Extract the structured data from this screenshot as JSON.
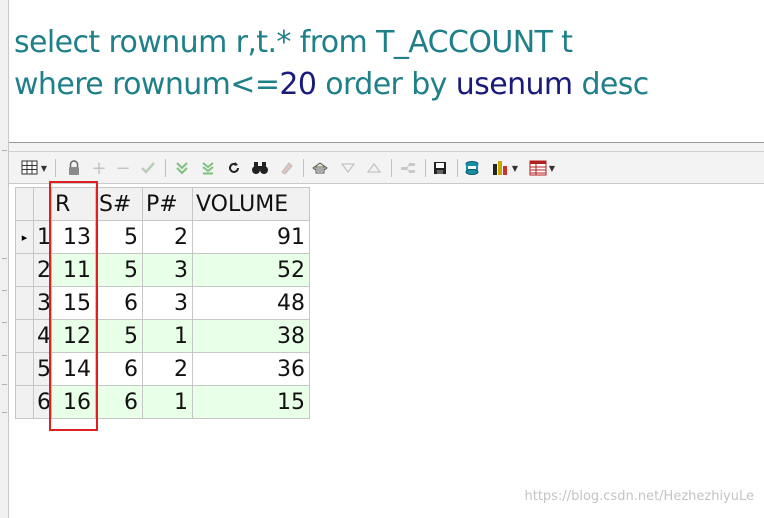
{
  "editor": {
    "line1": [
      {
        "text": "select ",
        "kind": "kw"
      },
      {
        "text": "rownum ",
        "kind": "kw"
      },
      {
        "text": "r,t.* ",
        "kind": "kw"
      },
      {
        "text": "from ",
        "kind": "kw"
      },
      {
        "text": "T_ACCOUNT ",
        "kind": "kw"
      },
      {
        "text": "t",
        "kind": "kw"
      }
    ],
    "line2": [
      {
        "text": "where ",
        "kind": "kw"
      },
      {
        "text": "rownum",
        "kind": "kw"
      },
      {
        "text": "<=",
        "kind": "kw"
      },
      {
        "text": "20 ",
        "kind": "num"
      },
      {
        "text": "order by ",
        "kind": "kw"
      },
      {
        "text": "usenum ",
        "kind": "id"
      },
      {
        "text": "desc",
        "kind": "kw"
      }
    ]
  },
  "toolbar": {
    "icons": [
      "grid-view-icon",
      "lock-icon",
      "add-record-icon",
      "delete-record-icon",
      "post-changes-icon",
      "fetch-next-icon",
      "fetch-last-icon",
      "refresh-icon",
      "find-icon",
      "clear-icon",
      "query-by-example-icon",
      "previous-icon",
      "next-icon",
      "single-record-icon",
      "save-icon",
      "export-icon",
      "chart-icon",
      "table-icon"
    ]
  },
  "grid": {
    "columns": [
      "R",
      "S#",
      "P#",
      "VOLUME"
    ],
    "rows": [
      {
        "num": "1",
        "r": "13",
        "s": "5",
        "p": "2",
        "volume": "91"
      },
      {
        "num": "2",
        "r": "11",
        "s": "5",
        "p": "3",
        "volume": "52"
      },
      {
        "num": "3",
        "r": "15",
        "s": "6",
        "p": "3",
        "volume": "48"
      },
      {
        "num": "4",
        "r": "12",
        "s": "5",
        "p": "1",
        "volume": "38"
      },
      {
        "num": "5",
        "r": "14",
        "s": "6",
        "p": "2",
        "volume": "36"
      },
      {
        "num": "6",
        "r": "16",
        "s": "6",
        "p": "1",
        "volume": "15"
      }
    ],
    "current_row_marker": "▸",
    "alt_row_color": "#e8ffe8"
  },
  "watermark": "https://blog.csdn.net/HezhezhiyuLe",
  "colors": {
    "sql_keyword": "#20808a",
    "sql_identifier": "#1a1a7a",
    "highlight": "#e02020"
  }
}
